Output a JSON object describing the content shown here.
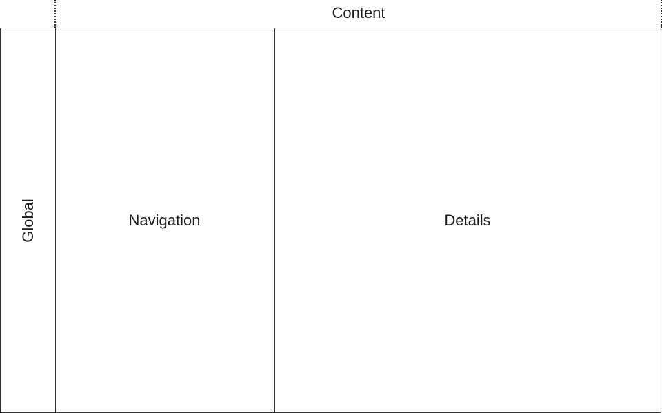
{
  "content_label": "Content",
  "panels": {
    "global": "Global",
    "navigation": "Navigation",
    "details": "Details"
  },
  "colors": {
    "line": "#333333",
    "text": "#1a1a1a",
    "background": "#ffffff"
  }
}
